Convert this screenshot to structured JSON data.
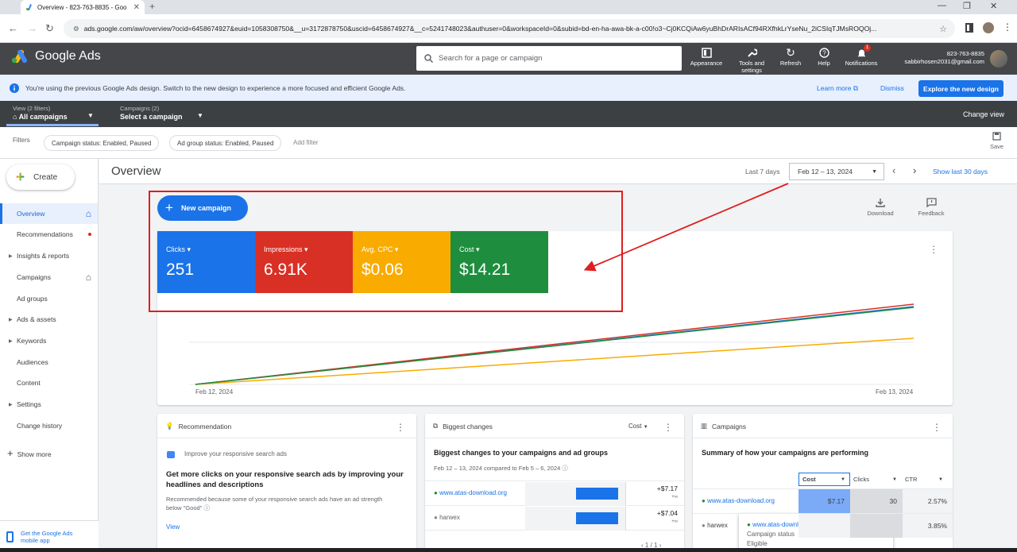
{
  "browser": {
    "tab_title": "Overview - 823-763-8835 - Goo",
    "url": "ads.google.com/aw/overview?ocid=6458674927&euid=1058308750&__u=3172878750&uscid=6458674927&__c=5241748023&authuser=0&workspaceId=0&subid=bd-en-ha-awa-bk-a-c00!o3~Cj0KCQiAw6yuBhDrARIsACf94RXfhkLrYseNu_2iCSIqTJMsROQOj..."
  },
  "header": {
    "product": "Google Ads",
    "search_placeholder": "Search for a page or campaign",
    "buttons": [
      {
        "label": "Appearance"
      },
      {
        "label": "Tools and settings"
      },
      {
        "label": "Refresh"
      },
      {
        "label": "Help"
      },
      {
        "label": "Notifications",
        "badge": "1"
      }
    ],
    "account_id": "823-763-8835",
    "email": "sabbirhosen2031@gmail.com"
  },
  "banner": {
    "text": "You're using the previous Google Ads design. Switch to the new design to experience a more focused and efficient Google Ads.",
    "learn_more": "Learn more",
    "dismiss": "Dismiss",
    "explore": "Explore the new design"
  },
  "viewbar": {
    "view_small": "View (2 filters)",
    "view_big": "All campaigns",
    "camp_small": "Campaigns (2)",
    "camp_big": "Select a campaign",
    "change_view": "Change view"
  },
  "filters": {
    "label": "Filters",
    "chips": [
      "Campaign status: Enabled, Paused",
      "Ad group status: Enabled, Paused"
    ],
    "add": "Add filter",
    "save": "Save"
  },
  "sidebar": {
    "create": "Create",
    "items": [
      {
        "label": "Overview",
        "active": true,
        "home": true
      },
      {
        "label": "Recommendations",
        "dot": true
      },
      {
        "label": "Insights & reports",
        "caret": true
      },
      {
        "label": "Campaigns",
        "home": true
      },
      {
        "label": "Ad groups"
      },
      {
        "label": "Ads & assets",
        "caret": true
      },
      {
        "label": "Keywords",
        "caret": true
      },
      {
        "label": "Audiences"
      },
      {
        "label": "Content"
      },
      {
        "label": "Settings",
        "caret": true
      },
      {
        "label": "Change history"
      }
    ],
    "show_more": "Show more",
    "mobile": "Get the Google Ads mobile app"
  },
  "overview": {
    "title": "Overview",
    "last7": "Last 7 days",
    "date_range": "Feb 12 – 13, 2024",
    "show30": "Show last 30 days",
    "new_campaign": "New campaign",
    "download": "Download",
    "feedback": "Feedback",
    "metrics": [
      {
        "label": "Clicks",
        "value": "251",
        "color": "#1a73e8"
      },
      {
        "label": "Impressions",
        "value": "6.91K",
        "color": "#d93025"
      },
      {
        "label": "Avg. CPC",
        "value": "$0.06",
        "color": "#f9ab00"
      },
      {
        "label": "Cost",
        "value": "$14.21",
        "color": "#1e8e3e"
      }
    ]
  },
  "chart_data": {
    "type": "line",
    "x": [
      "Feb 12, 2024",
      "Feb 13, 2024"
    ],
    "series": [
      {
        "name": "Clicks",
        "color": "#1a73e8",
        "values": [
          0,
          251
        ]
      },
      {
        "name": "Impressions",
        "color": "#d93025",
        "values": [
          0,
          6910
        ]
      },
      {
        "name": "Avg. CPC",
        "color": "#f9ab00",
        "values": [
          0,
          0.06
        ]
      },
      {
        "name": "Cost",
        "color": "#1e8e3e",
        "values": [
          0,
          14.21
        ]
      }
    ],
    "grid": true,
    "legend": "none"
  },
  "recommendation": {
    "title": "Recommendation",
    "subtitle": "Improve your responsive search ads",
    "headline": "Get more clicks on your responsive search ads by improving your headlines and descriptions",
    "body": "Recommended because some of your responsive search ads have an ad strength below \"Good\"",
    "view": "View"
  },
  "changes": {
    "title": "Biggest changes",
    "metric": "Cost",
    "headline": "Biggest changes to your campaigns and ad groups",
    "compare": "Feb 12 – 13, 2024 compared to Feb 5 – 6, 2024",
    "rows": [
      {
        "name": "www.atas-download.org",
        "value": "+$7.17",
        "sub": "+∞",
        "active": true
      },
      {
        "name": "harwex",
        "value": "+$7.04",
        "sub": "+∞",
        "active": false
      }
    ],
    "pager": "1 / 1"
  },
  "campaigns": {
    "title": "Campaigns",
    "headline": "Summary of how your campaigns are performing",
    "columns": [
      "Cost",
      "Clicks",
      "CTR"
    ],
    "rows": [
      {
        "name": "www.atas-download.org",
        "cost": "$7.17",
        "clicks": "30",
        "ctr": "2.57%",
        "active": true
      },
      {
        "name": "harwex",
        "cost": "",
        "clicks": "",
        "ctr": "3.85%",
        "active": false
      }
    ],
    "tooltip": {
      "name": "www.atas-download.org",
      "status": "Campaign status",
      "status_value": "Eligible"
    }
  }
}
